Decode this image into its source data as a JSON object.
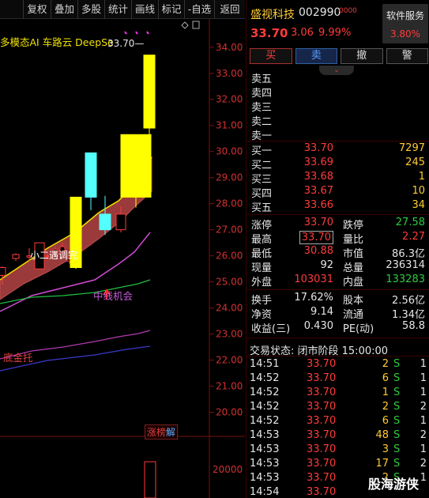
{
  "toolbar": {
    "items": [
      "复权",
      "叠加",
      "多股",
      "统计",
      "画线",
      "标记",
      "-自选",
      "返回"
    ]
  },
  "chart": {
    "indicator_title": "多模态AI 车路云 DeepSe",
    "high_price_label": "33.70",
    "price_axis": [
      "34.00",
      "33.00",
      "32.00",
      "31.00",
      "30.00",
      "29.00",
      "28.00",
      "27.00",
      "26.00",
      "25.00",
      "24.00",
      "23.00",
      "22.00",
      "21.00",
      "20.00"
    ],
    "volume_axis": [
      "20000",
      "10000"
    ],
    "label_small": "小二遇调完",
    "label_mid": "中线机会",
    "label_low": "底金托",
    "zhangbang_prefix": "涨榜",
    "zhangbang_suffix": "解"
  },
  "chart_data": {
    "type": "candlestick",
    "price_range": [
      19.5,
      34.6
    ],
    "candles": [
      {
        "open": 25.25,
        "close": 25.55,
        "high": 25.6,
        "low": 24.9,
        "color": "red"
      },
      {
        "open": 25.9,
        "close": 26.05,
        "high": 26.1,
        "low": 25.8,
        "color": "red"
      },
      {
        "open": 25.95,
        "close": 26.0,
        "high": 26.3,
        "low": 25.8,
        "color": "red"
      },
      {
        "open": 25.5,
        "close": 26.5,
        "high": 26.5,
        "low": 25.5,
        "color": "red"
      },
      {
        "open": 26.0,
        "close": 26.0,
        "high": 26.15,
        "low": 25.85,
        "color": "red"
      },
      {
        "open": 26.15,
        "close": 26.25,
        "high": 26.35,
        "low": 26.0,
        "color": "red"
      },
      {
        "open": 26.35,
        "close": 26.15,
        "high": 26.5,
        "low": 26.05,
        "color": "red"
      },
      {
        "open": 25.8,
        "close": 25.9,
        "high": 26.0,
        "low": 25.7,
        "color": "red"
      },
      {
        "open": 25.55,
        "close": 28.25,
        "high": 28.25,
        "low": 25.5,
        "color": "yellow"
      },
      {
        "open": 29.95,
        "close": 28.25,
        "high": 29.95,
        "low": 27.75,
        "color": "cyan"
      },
      {
        "open": 27.6,
        "close": 27.0,
        "high": 28.3,
        "low": 26.8,
        "color": "cyan"
      },
      {
        "open": 27.0,
        "close": 27.6,
        "high": 27.9,
        "low": 26.9,
        "color": "red"
      },
      {
        "open": 28.25,
        "close": 30.65,
        "high": 30.65,
        "low": 27.85,
        "color": "yellow"
      },
      {
        "open": 30.9,
        "close": 33.7,
        "high": 33.7,
        "low": 30.5,
        "color": "yellow"
      }
    ],
    "volumes": [
      17000
    ]
  },
  "quote": {
    "name": "盛视科技",
    "code": "002990",
    "tag": "0000",
    "price": "33.70",
    "change": "3.06",
    "pct": "9.99%",
    "sector_name": "软件服务",
    "sector_pct": "3.80%",
    "buttons": [
      "买",
      "卖",
      "撤",
      "警"
    ],
    "sell_levels": [
      {
        "label": "卖五",
        "price": "",
        "vol": ""
      },
      {
        "label": "卖四",
        "price": "",
        "vol": ""
      },
      {
        "label": "卖三",
        "price": "",
        "vol": ""
      },
      {
        "label": "卖二",
        "price": "",
        "vol": ""
      },
      {
        "label": "卖一",
        "price": "",
        "vol": ""
      }
    ],
    "buy_levels": [
      {
        "label": "买一",
        "price": "33.70",
        "vol": "7297"
      },
      {
        "label": "买二",
        "price": "33.69",
        "vol": "245"
      },
      {
        "label": "买三",
        "price": "33.68",
        "vol": "1"
      },
      {
        "label": "买四",
        "price": "33.67",
        "vol": "10"
      },
      {
        "label": "买五",
        "price": "33.66",
        "vol": "34"
      }
    ],
    "stats": {
      "limit_up_label": "涨停",
      "limit_up": "33.70",
      "limit_down_label": "跌停",
      "limit_down": "27.58",
      "high_label": "最高",
      "high": "33.70",
      "vol_ratio_label": "量比",
      "vol_ratio": "2.27",
      "low_label": "最低",
      "low": "30.88",
      "mkt_cap_label": "市值",
      "mkt_cap": "86.3亿",
      "now_label": "现量",
      "now": "92",
      "total_vol_label": "总量",
      "total_vol": "236314",
      "outer_label": "外盘",
      "outer": "103031",
      "inner_label": "内盘",
      "inner": "133283"
    },
    "fund": {
      "turnover_label": "换手",
      "turnover": "17.62%",
      "equity_label": "股本",
      "equity": "2.56亿",
      "nav_label": "净资",
      "nav": "9.14",
      "float_label": "流通",
      "float": "1.34亿",
      "eps_label": "收益(三)",
      "eps": "0.430",
      "pe_label": "PE(动)",
      "pe": "58.8"
    },
    "status_line": "交易状态: 闭市阶段 15:00:00",
    "ticks": [
      {
        "time": "14:51",
        "price": "33.70",
        "vol": "2",
        "side": "S",
        "count": "1"
      },
      {
        "time": "14:52",
        "price": "33.70",
        "vol": "6",
        "side": "S",
        "count": "1"
      },
      {
        "time": "14:52",
        "price": "33.70",
        "vol": "1",
        "side": "S",
        "count": "1"
      },
      {
        "time": "14:52",
        "price": "33.70",
        "vol": "2",
        "side": "S",
        "count": "2"
      },
      {
        "time": "14:52",
        "price": "33.70",
        "vol": "6",
        "side": "S",
        "count": "1"
      },
      {
        "time": "14:53",
        "price": "33.70",
        "vol": "48",
        "side": "S",
        "count": "2"
      },
      {
        "time": "14:53",
        "price": "33.70",
        "vol": "3",
        "side": "S",
        "count": "1"
      },
      {
        "time": "14:53",
        "price": "33.70",
        "vol": "17",
        "side": "S",
        "count": "2"
      },
      {
        "time": "14:53",
        "price": "33.70",
        "vol": "2",
        "side": "S",
        "count": "1"
      },
      {
        "time": "14:54",
        "price": "33.70",
        "vol": "",
        "side": "",
        "count": ""
      }
    ]
  },
  "watermark": "股海游侠"
}
